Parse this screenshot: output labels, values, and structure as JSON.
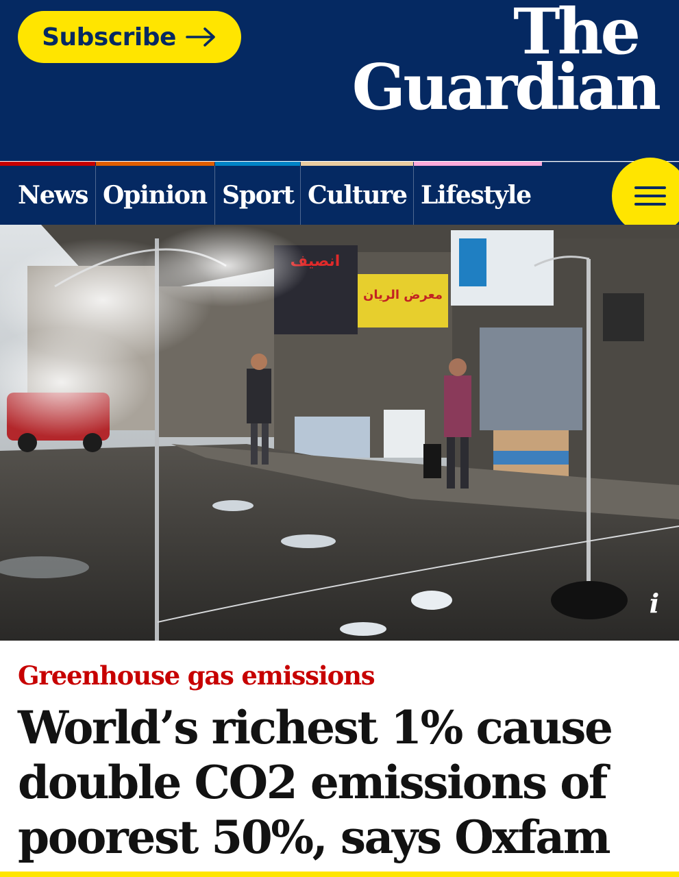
{
  "header": {
    "subscribe_label": "Subscribe",
    "logo_line1": "The",
    "logo_line2": "Guardian",
    "brand_color": "#052962",
    "accent_color": "#ffe500"
  },
  "nav": {
    "items": [
      {
        "label": "News",
        "color": "#c70000"
      },
      {
        "label": "Opinion",
        "color": "#e05e00"
      },
      {
        "label": "Sport",
        "color": "#0084c6"
      },
      {
        "label": "Culture",
        "color": "#eacca0"
      },
      {
        "label": "Lifestyle",
        "color": "#ffabdb"
      }
    ],
    "menu_icon": "hamburger-icon"
  },
  "hero": {
    "image": "street-market-with-water-misters",
    "info_label": "i"
  },
  "article": {
    "kicker": "Greenhouse gas emissions",
    "kicker_color": "#c70000",
    "headline": "World’s richest 1% cause double CO2 emissions of poorest 50%, says Oxfam"
  }
}
